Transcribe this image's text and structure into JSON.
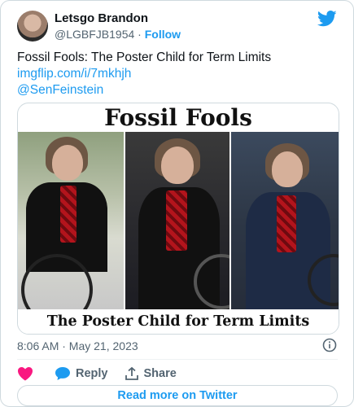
{
  "tweet": {
    "author_name": "Letsgo Brandon",
    "handle": "@LGBFJB1954",
    "separator": "·",
    "follow_label": "Follow",
    "text_line": "Fossil Fools: The Poster Child for Term Limits",
    "link_text": "imgflip.com/i/7mkhjh",
    "mention": "@SenFeinstein",
    "timestamp": "8:06 AM · May 21, 2023"
  },
  "media": {
    "top_caption": "Fossil Fools",
    "bottom_caption": "The Poster Child for Term Limits"
  },
  "actions": {
    "like_count": "",
    "reply_label": "Reply",
    "share_label": "Share"
  },
  "read_more_label": "Read more on Twitter",
  "colors": {
    "accent": "#1d9bf0",
    "like": "#f91880",
    "text": "#0f1419",
    "muted": "#536471"
  },
  "icons": {
    "brand": "twitter-bird-icon",
    "info": "info-icon",
    "like": "heart-icon",
    "reply": "reply-bubble-icon",
    "share": "share-upload-icon"
  }
}
